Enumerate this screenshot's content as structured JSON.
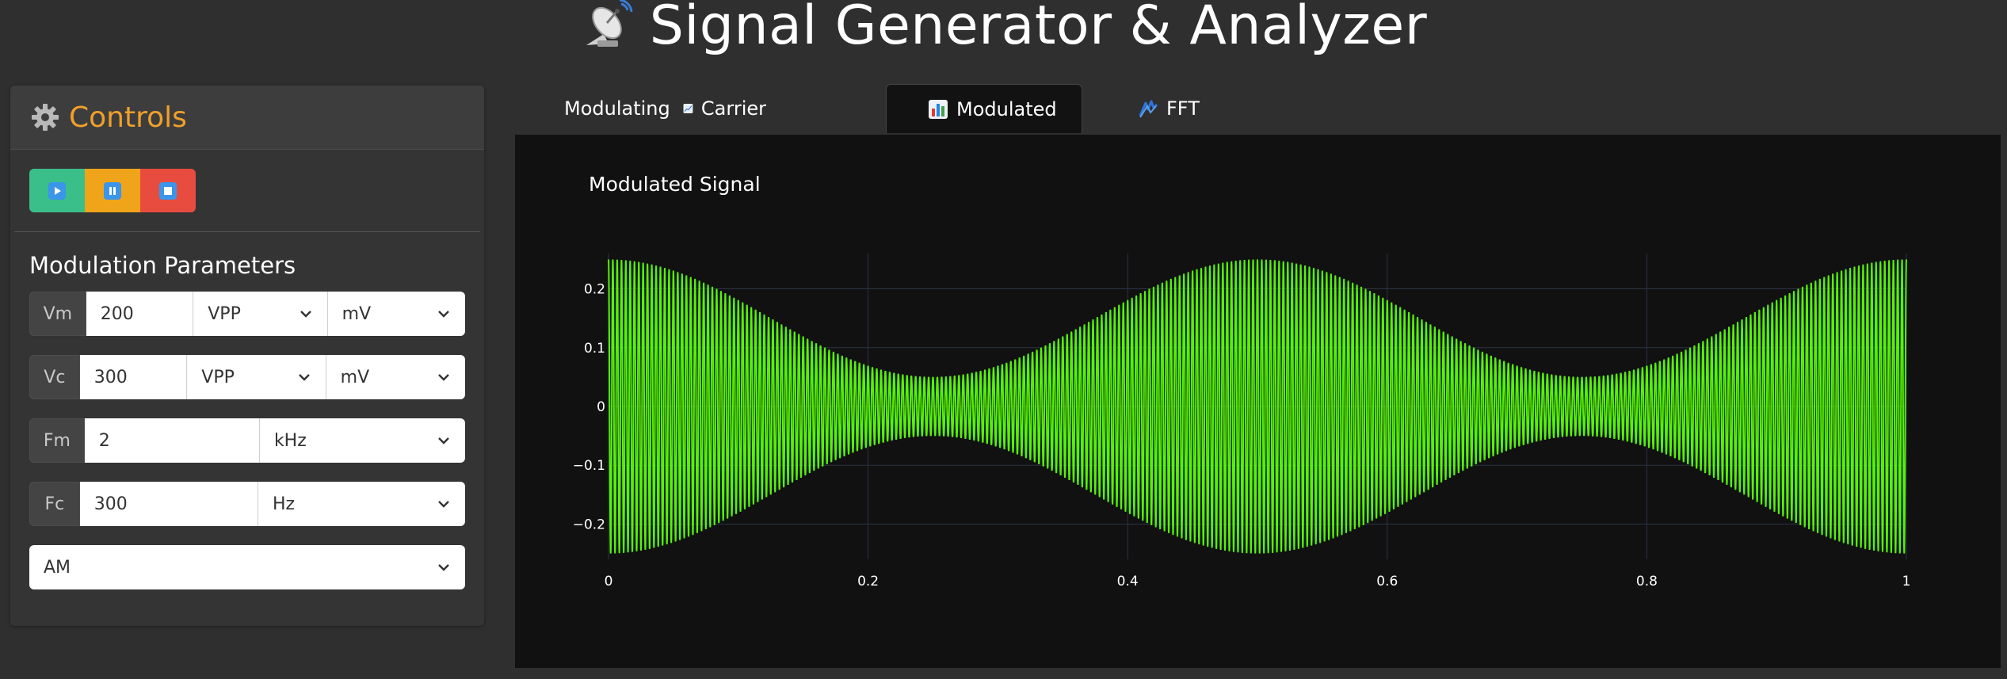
{
  "header": {
    "title": "Signal Generator & Analyzer",
    "icon": "satellite-dish-icon"
  },
  "controls": {
    "title": "Controls",
    "icon": "gear-icon",
    "buttons": [
      {
        "name": "play-button",
        "icon": "play-icon",
        "color": "#3bbf8a"
      },
      {
        "name": "pause-button",
        "icon": "pause-icon",
        "color": "#f0a41a"
      },
      {
        "name": "stop-button",
        "icon": "stop-icon",
        "color": "#e84c3f"
      }
    ],
    "section_title": "Modulation Parameters",
    "vm": {
      "label": "Vm",
      "value": "200",
      "type": "VPP",
      "unit": "mV"
    },
    "vc": {
      "label": "Vc",
      "value": "300",
      "type": "VPP",
      "unit": "mV"
    },
    "fm": {
      "label": "Fm",
      "value": "2",
      "unit": "kHz"
    },
    "fc": {
      "label": "Fc",
      "value": "300",
      "unit": "Hz"
    },
    "modulation": "AM"
  },
  "tabs": [
    {
      "label": "Modulating",
      "icon": "line-chart-down-icon",
      "active": false
    },
    {
      "label": "Carrier",
      "icon": "line-chart-up-icon",
      "active": false
    },
    {
      "label": "Modulated",
      "icon": "bar-chart-icon",
      "active": true
    },
    {
      "label": "FFT",
      "icon": "spectrum-icon",
      "active": false
    }
  ],
  "chart_data": {
    "type": "line",
    "title": "Modulated Signal",
    "xlabel": "",
    "ylabel": "",
    "xlim": [
      0,
      1
    ],
    "ylim": [
      -0.26,
      0.26
    ],
    "x_ticks": [
      0,
      0.2,
      0.4,
      0.6,
      0.8,
      1
    ],
    "x_tick_labels": [
      "0",
      "0.2",
      "0.4",
      "0.6",
      "0.8",
      "1"
    ],
    "y_ticks": [
      0.2,
      0.1,
      0,
      -0.1,
      -0.2
    ],
    "y_tick_labels": [
      "0.2",
      "0.1",
      "0",
      "−0.1",
      "−0.2"
    ],
    "grid": true,
    "series_color": "#55f20a",
    "carrier_cycles": 300,
    "envelope_cycles": 2,
    "peak_amplitude": 0.25,
    "min_amplitude": 0.05
  }
}
